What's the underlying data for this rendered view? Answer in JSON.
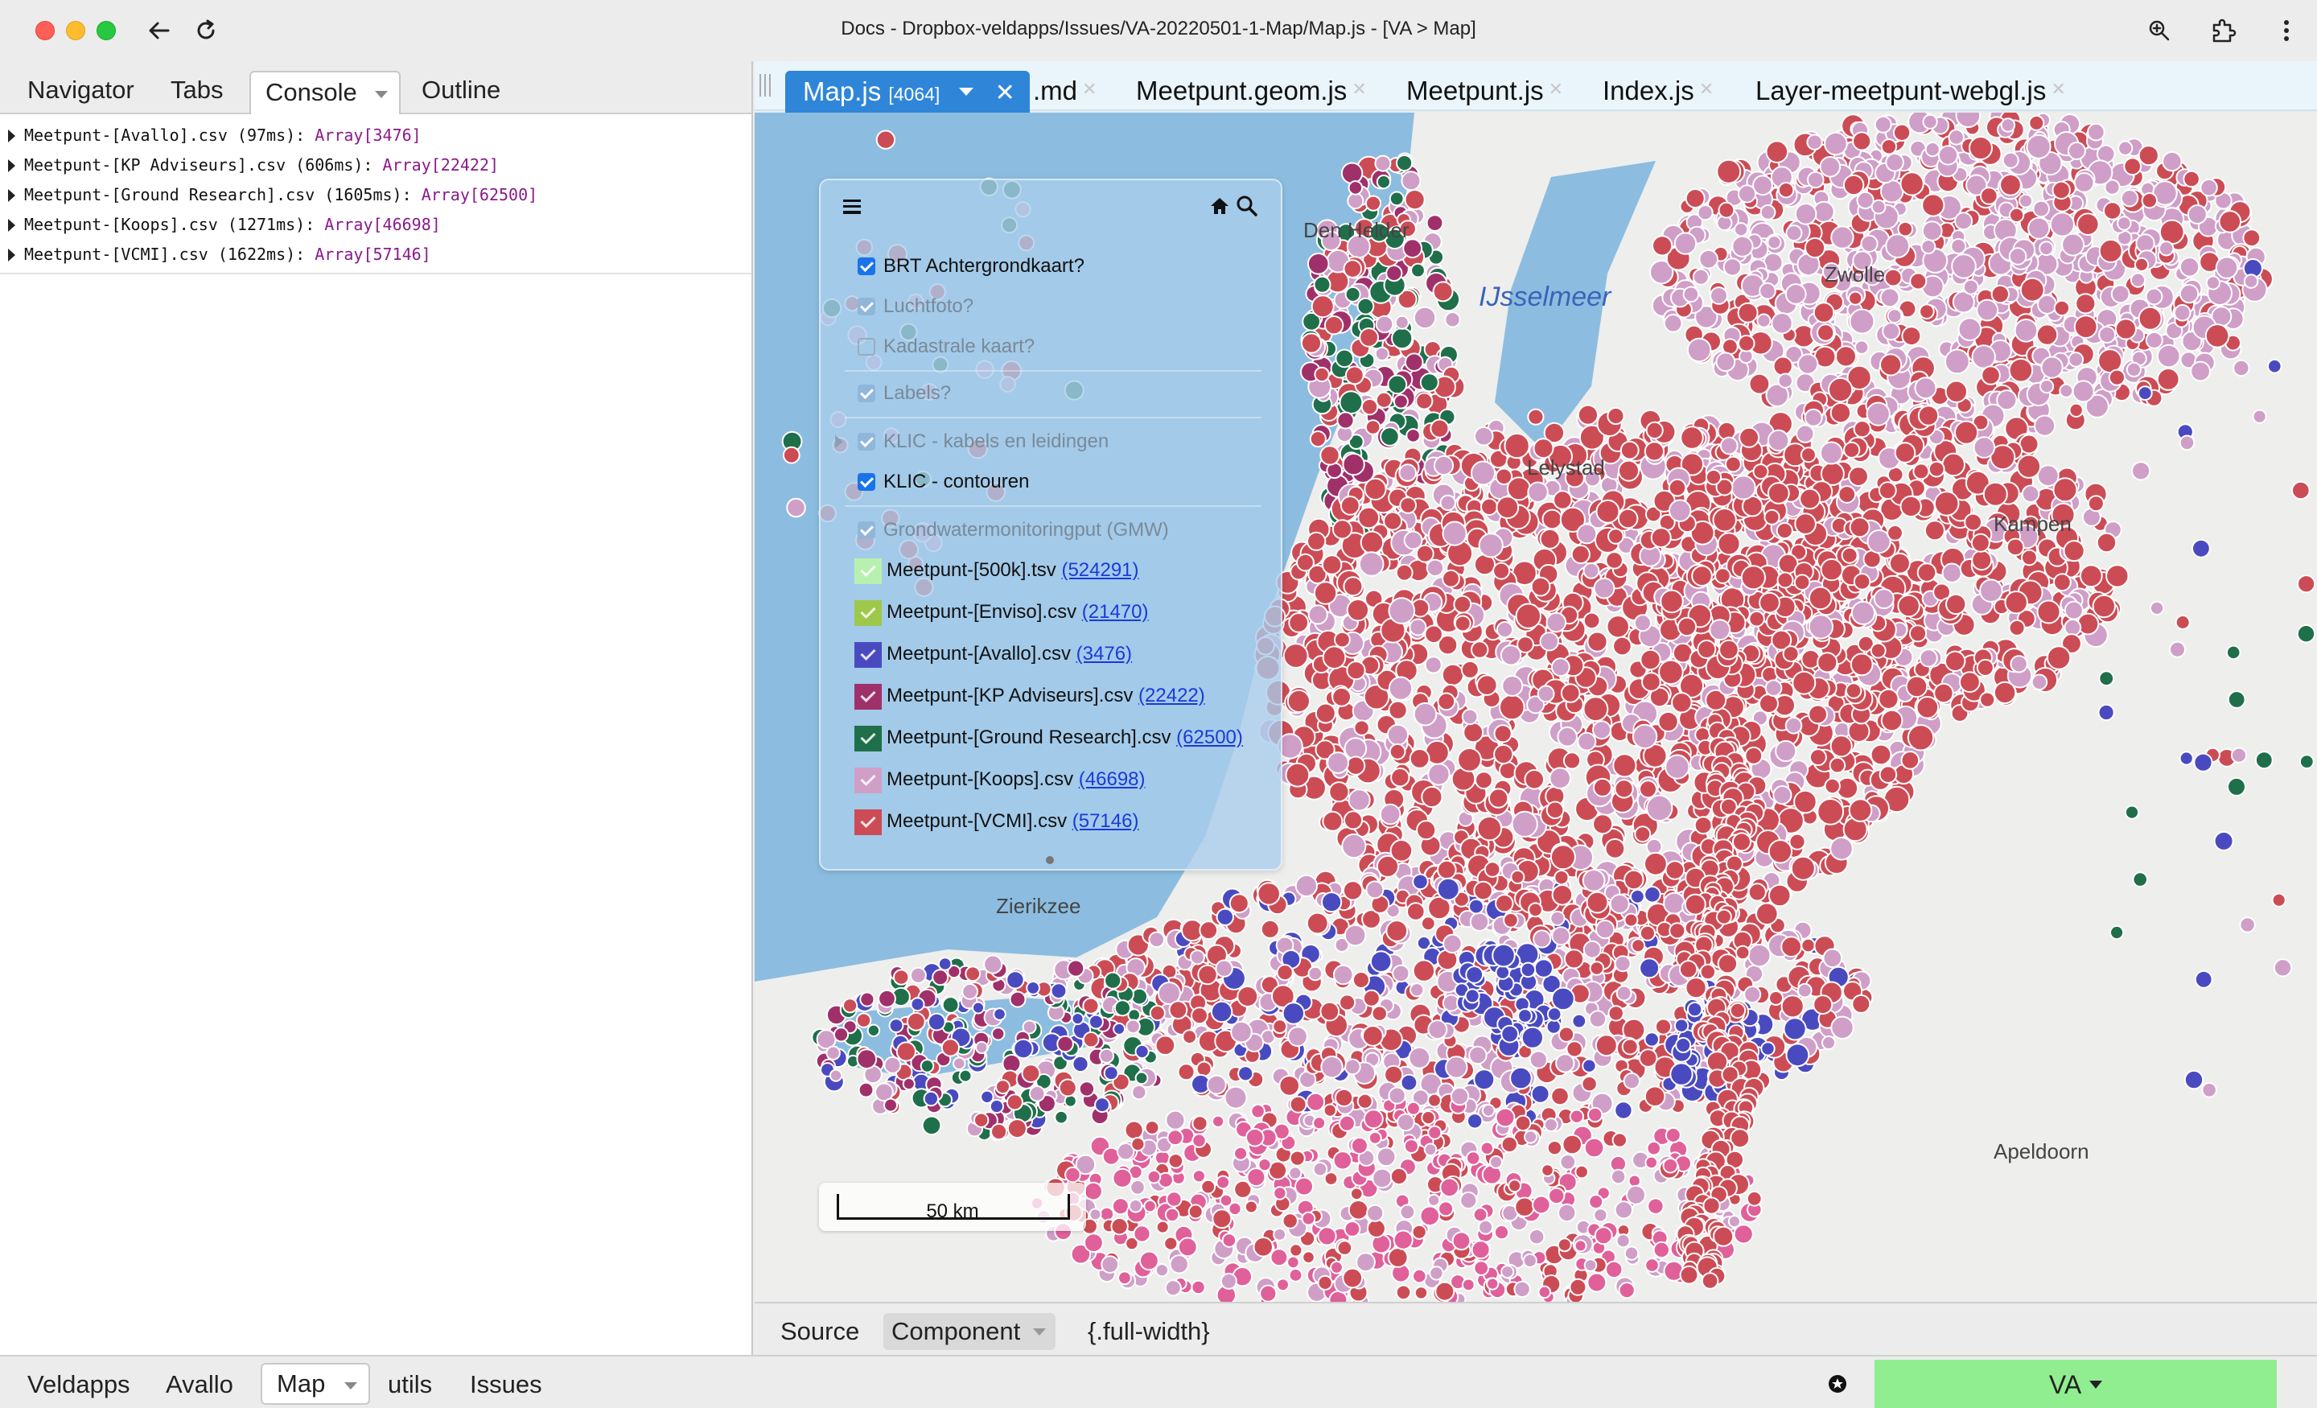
{
  "window": {
    "title": "Docs - Dropbox-veldapps/Issues/VA-20220501-1-Map/Map.js - [VA > Map]"
  },
  "left_tabs": [
    "Navigator",
    "Tabs",
    "Console",
    "Outline"
  ],
  "console": {
    "lines": [
      {
        "text": "Meetpunt-[Avallo].csv (97ms): ",
        "value": "Array[3476]"
      },
      {
        "text": "Meetpunt-[KP Adviseurs].csv (606ms): ",
        "value": "Array[22422]"
      },
      {
        "text": "Meetpunt-[Ground Research].csv (1605ms): ",
        "value": "Array[62500]"
      },
      {
        "text": "Meetpunt-[Koops].csv (1271ms): ",
        "value": "Array[46698]"
      },
      {
        "text": "Meetpunt-[VCMI].csv (1622ms): ",
        "value": "Array[57146]"
      }
    ]
  },
  "editor_tabs": {
    "active": {
      "name": "Map.js",
      "count": "[4064]"
    },
    "others": [
      ".md",
      "Meetpunt.geom.js",
      "Meetpunt.js",
      "Index.js",
      "Layer-meetpunt-webgl.js"
    ]
  },
  "layers": {
    "base": [
      {
        "label": "BRT Achtergrondkaart?",
        "checked": true,
        "dim": false
      },
      {
        "label": "Luchtfoto?",
        "checked": true,
        "dim": true
      },
      {
        "label": "Kadastrale kaart?",
        "checked": false,
        "dim": true
      },
      {
        "label": "Labels?",
        "checked": true,
        "dim": true
      },
      {
        "label": "KLIC - kabels en leidingen",
        "checked": true,
        "dim": true
      },
      {
        "label": "KLIC - contouren",
        "checked": true,
        "dim": false
      },
      {
        "label": "Grondwatermonitoringput (GMW)",
        "checked": true,
        "dim": true
      }
    ],
    "datasets": [
      {
        "label": "Meetpunt-[500k].tsv ",
        "count": "(524291)",
        "color": "#b8f0b0"
      },
      {
        "label": "Meetpunt-[Enviso].csv ",
        "count": "(21470)",
        "color": "#9ec84a"
      },
      {
        "label": "Meetpunt-[Avallo].csv ",
        "count": "(3476)",
        "color": "#4a4ac0"
      },
      {
        "label": "Meetpunt-[KP Adviseurs].csv ",
        "count": "(22422)",
        "color": "#a0306a"
      },
      {
        "label": "Meetpunt-[Ground Research].csv ",
        "count": "(62500)",
        "color": "#1f6f4a"
      },
      {
        "label": "Meetpunt-[Koops].csv ",
        "count": "(46698)",
        "color": "#cf9fc8"
      },
      {
        "label": "Meetpunt-[VCMI].csv ",
        "count": "(57146)",
        "color": "#cc4c55"
      }
    ]
  },
  "map": {
    "scale": "50 km",
    "place_labels": [
      "Den Helder",
      "IJsselmeer",
      "Zierikzee",
      "Zwolle",
      "Kampen",
      "Lelystad",
      "Apeldoorn"
    ]
  },
  "bottom_tabs": [
    "Source",
    "Component",
    "{.full-width}"
  ],
  "status_tabs": [
    "Veldapps",
    "Avallo",
    "Map",
    "utils",
    "Issues"
  ],
  "va_button": "VA",
  "colors": {
    "water": "#8cbde0",
    "land": "#eeeeec",
    "vcmi": "#cc4c55",
    "koops": "#cf9fc8",
    "ground_research": "#1f6f4a",
    "avallo": "#4a4ac0",
    "kp_adviseurs": "#a0306a",
    "pink": "#e0609a"
  }
}
